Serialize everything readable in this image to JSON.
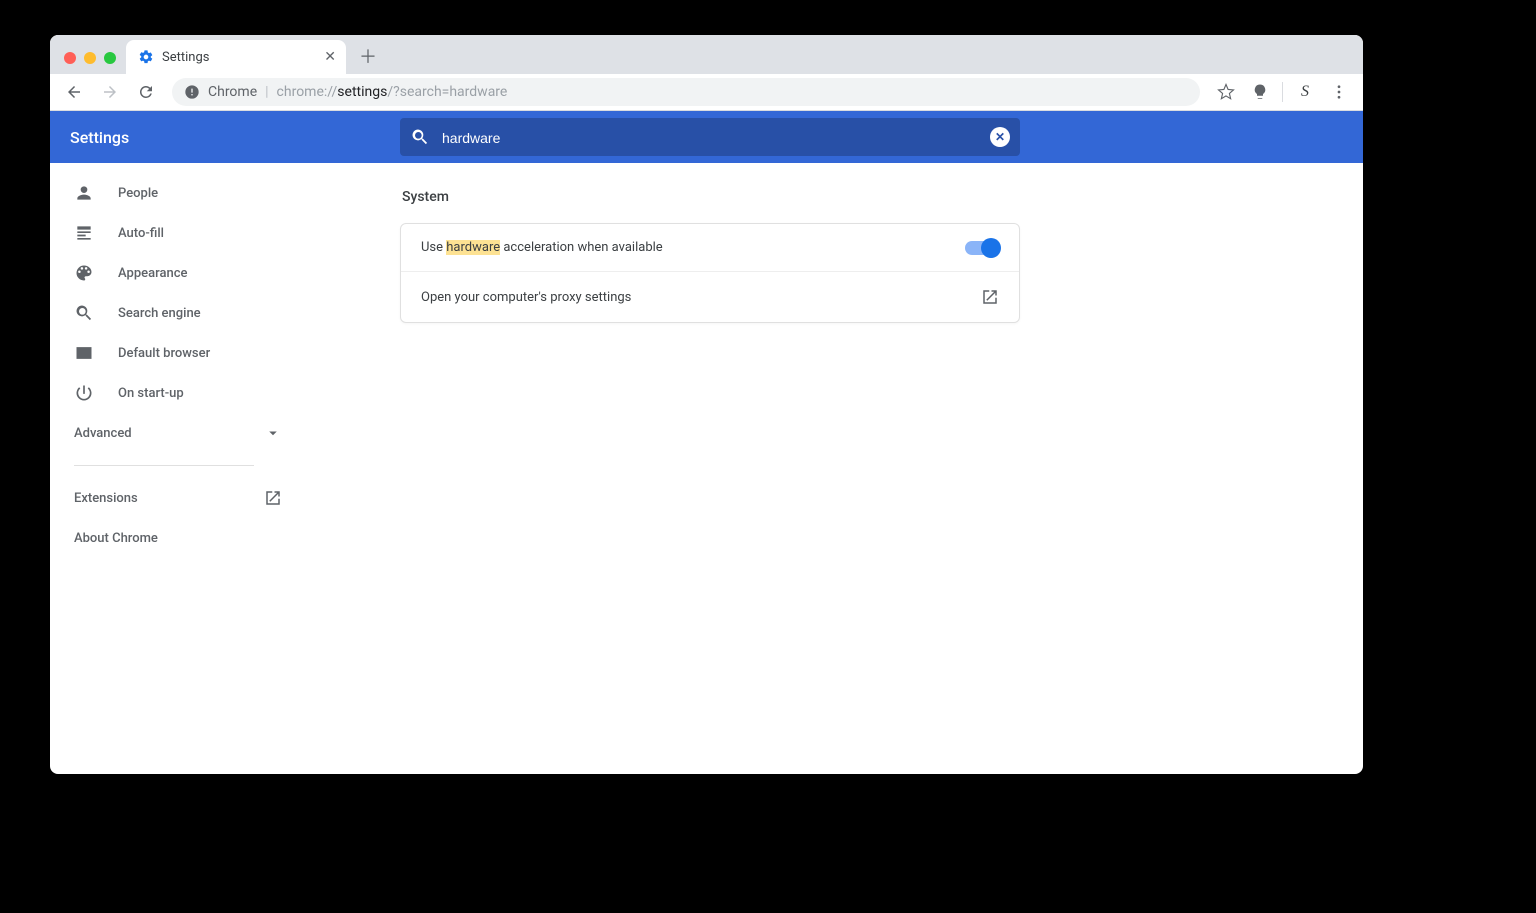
{
  "tab": {
    "title": "Settings"
  },
  "omnibox": {
    "prefix": "Chrome",
    "url_before": "chrome://",
    "url_bold": "settings",
    "url_after": "/?search=hardware"
  },
  "header": {
    "title": "Settings"
  },
  "search": {
    "value": "hardware"
  },
  "sidebar": {
    "items": [
      {
        "label": "People"
      },
      {
        "label": "Auto-fill"
      },
      {
        "label": "Appearance"
      },
      {
        "label": "Search engine"
      },
      {
        "label": "Default browser"
      },
      {
        "label": "On start-up"
      }
    ],
    "advanced": "Advanced",
    "extensions": "Extensions",
    "about": "About Chrome"
  },
  "section": {
    "title": "System",
    "row1_prefix": "Use ",
    "row1_highlight": "hardware",
    "row1_suffix": " acceleration when available",
    "row2_label": "Open your computer's proxy settings"
  }
}
